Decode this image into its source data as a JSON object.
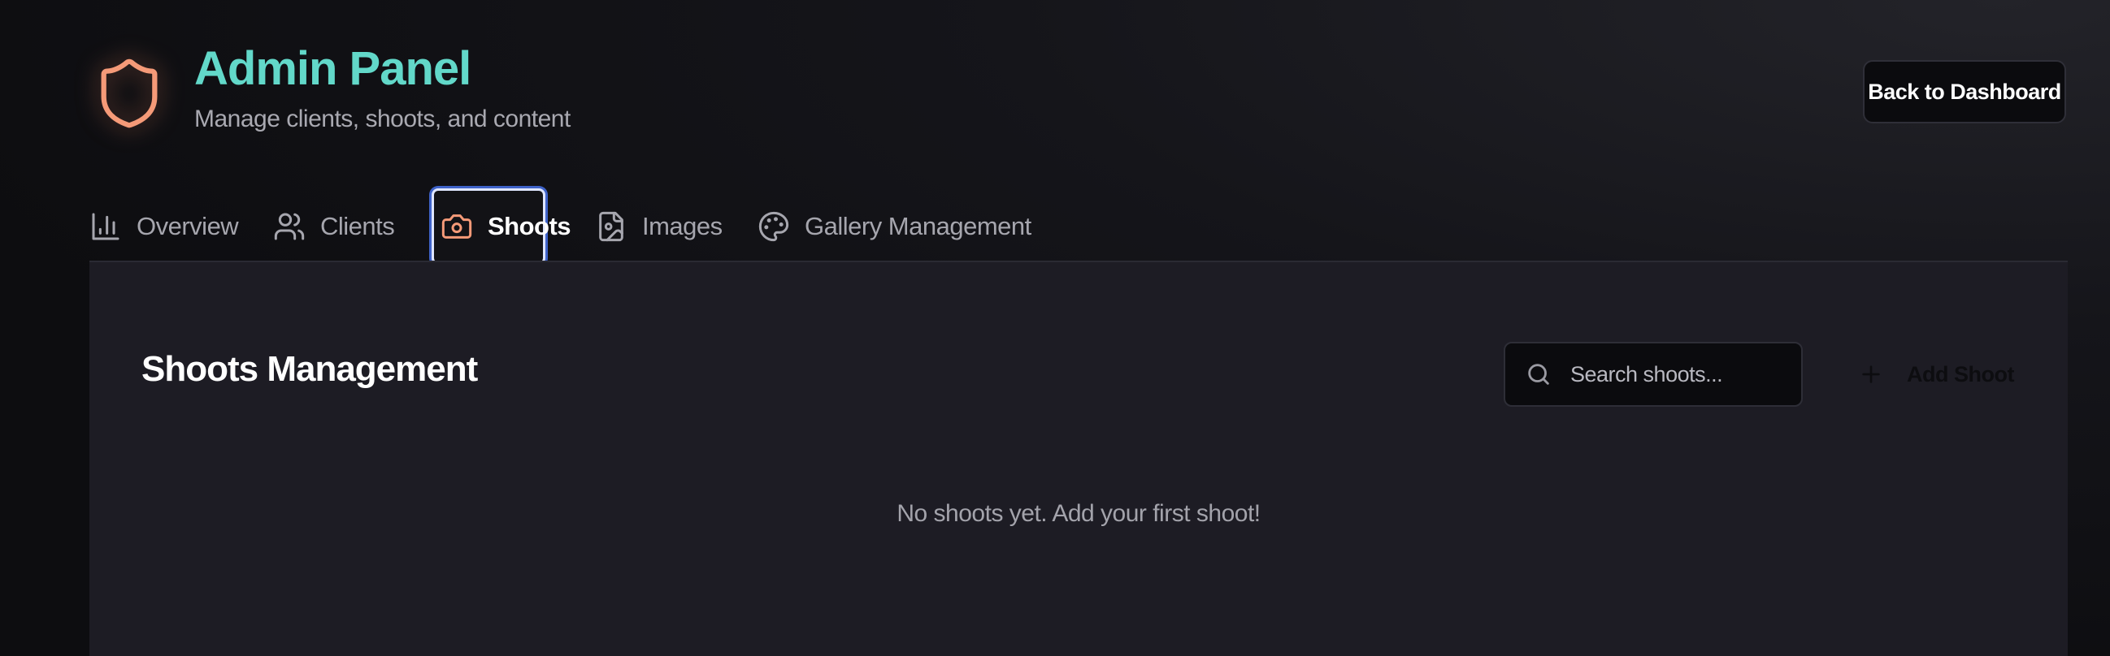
{
  "header": {
    "title": "Admin Panel",
    "subtitle": "Manage clients, shoots, and content",
    "logo_icon": "shield-icon",
    "back_button": "Back to Dashboard"
  },
  "tabs": [
    {
      "label": "Overview",
      "icon": "bar-chart-icon",
      "active": false
    },
    {
      "label": "Clients",
      "icon": "users-icon",
      "active": false
    },
    {
      "label": "Shoots",
      "icon": "camera-icon",
      "active": true
    },
    {
      "label": "Images",
      "icon": "image-file-icon",
      "active": false
    },
    {
      "label": "Gallery Management",
      "icon": "palette-icon",
      "active": false
    }
  ],
  "main": {
    "title": "Shoots Management",
    "search": {
      "placeholder": "Search shoots...",
      "value": "",
      "icon": "search-icon"
    },
    "add_button": {
      "label": "Add Shoot",
      "icon": "plus-icon"
    },
    "empty_message": "No shoots yet. Add your first shoot!"
  },
  "colors": {
    "accent_title": "#62d8c9",
    "accent_icon": "#f59a78",
    "active_tab_border": "#dfe6ff",
    "active_tab_glow": "#3e62c8",
    "panel_bg": "#1d1c24"
  }
}
